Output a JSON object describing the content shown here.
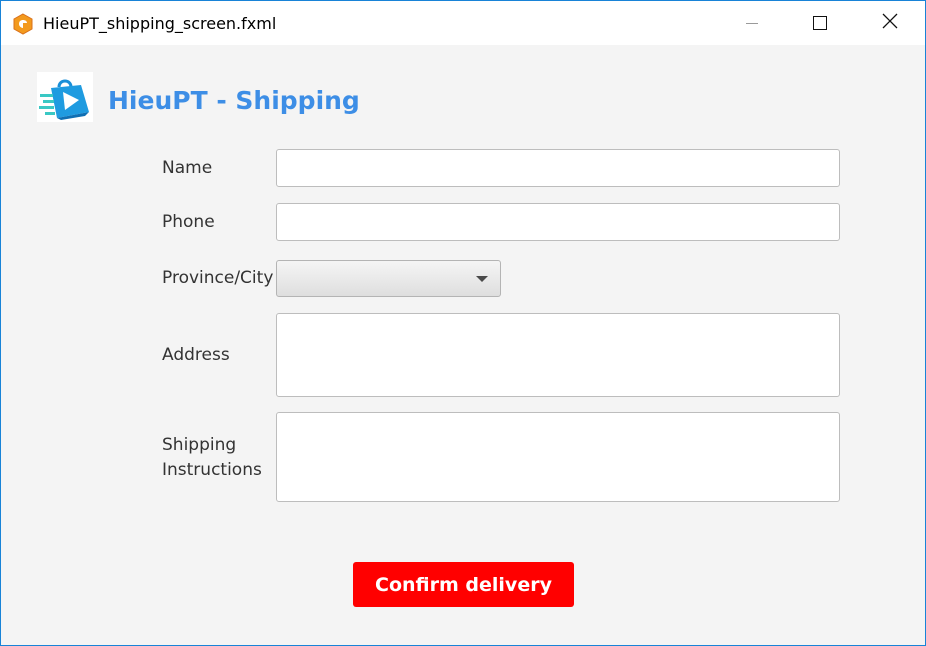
{
  "window": {
    "title": "HieuPT_shipping_screen.fxml",
    "icon": "scene-builder-app-icon",
    "controls": [
      "minimize-icon",
      "maximize-icon",
      "close-icon"
    ]
  },
  "header": {
    "logo_icon": "shopping-bag-delivery-icon",
    "title": "HieuPT - Shipping",
    "title_color": "#3d8ee6"
  },
  "form": {
    "name_label": "Name",
    "name_value": "",
    "phone_label": "Phone",
    "phone_value": "",
    "province_label": "Province/City",
    "province_selected": "",
    "address_label": "Address",
    "address_value": "",
    "shipping_label_line1": "Shipping",
    "shipping_label_line2": "Instructions",
    "shipping_value": ""
  },
  "actions": {
    "confirm_label": "Confirm delivery",
    "confirm_color": "#ff0000"
  }
}
